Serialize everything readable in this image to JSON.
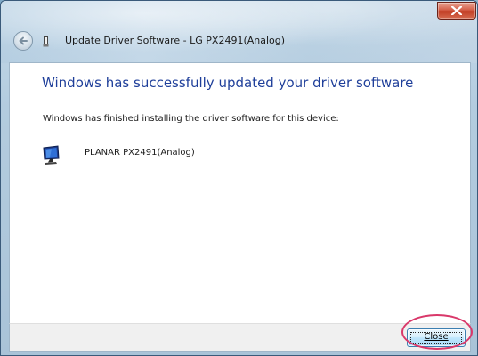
{
  "window": {
    "title": "Update Driver Software - LG PX2491(Analog)"
  },
  "icons": {
    "close": "close-icon",
    "back": "back-arrow-icon",
    "wizard": "wizard-icon",
    "monitor": "monitor-icon"
  },
  "content": {
    "heading": "Windows has successfully updated your driver software",
    "subtext": "Windows has finished installing the driver software for this device:",
    "device_name": "PLANAR PX2491(Analog)"
  },
  "footer": {
    "close_label": "Close"
  },
  "colors": {
    "heading": "#1f3f9a",
    "annotation": "#d9386a",
    "titlebar_close": "#c13d24",
    "button_border": "#3c7fb1"
  }
}
